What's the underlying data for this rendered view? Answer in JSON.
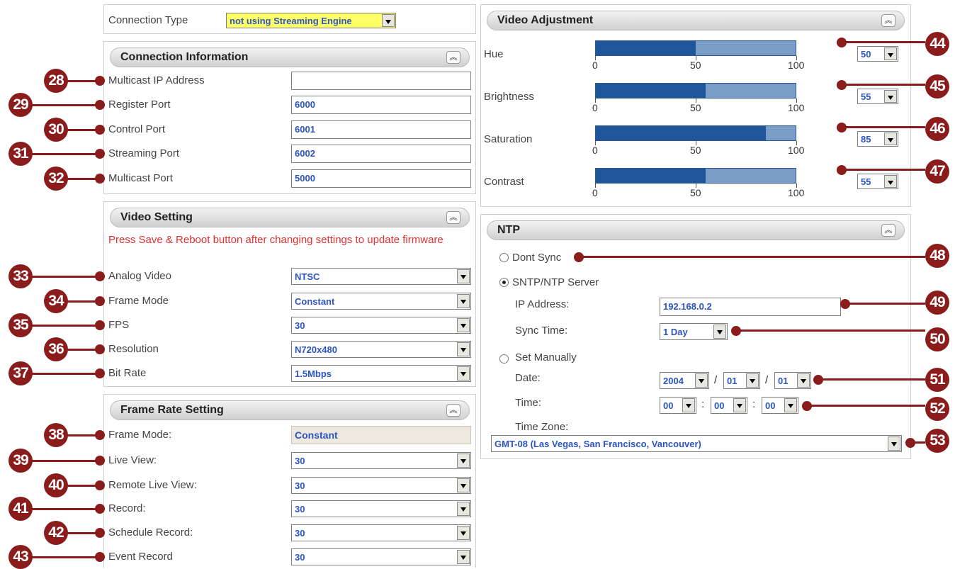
{
  "connection_type": {
    "label": "Connection Type",
    "value": "not using Streaming Engine"
  },
  "connection_info": {
    "title": "Connection Information",
    "fields": [
      {
        "marker": "28",
        "label": "Multicast IP Address",
        "value": ""
      },
      {
        "marker": "29",
        "label": "Register Port",
        "value": "6000"
      },
      {
        "marker": "30",
        "label": "Control Port",
        "value": "6001"
      },
      {
        "marker": "31",
        "label": "Streaming Port",
        "value": "6002"
      },
      {
        "marker": "32",
        "label": "Multicast Port",
        "value": "5000"
      }
    ]
  },
  "video_setting": {
    "title": "Video Setting",
    "warning": "Press Save & Reboot button after changing settings to update firmware",
    "fields": [
      {
        "marker": "33",
        "label": "Analog Video",
        "value": "NTSC"
      },
      {
        "marker": "34",
        "label": "Frame Mode",
        "value": "Constant"
      },
      {
        "marker": "35",
        "label": "FPS",
        "value": "30"
      },
      {
        "marker": "36",
        "label": "Resolution",
        "value": "N720x480"
      },
      {
        "marker": "37",
        "label": "Bit Rate",
        "value": "1.5Mbps"
      }
    ]
  },
  "frame_rate": {
    "title": "Frame Rate Setting",
    "fields": [
      {
        "marker": "38",
        "label": "Frame Mode:",
        "value": "Constant"
      },
      {
        "marker": "39",
        "label": "Live View:",
        "value": "30"
      },
      {
        "marker": "40",
        "label": "Remote Live View:",
        "value": "30"
      },
      {
        "marker": "41",
        "label": "Record:",
        "value": "30"
      },
      {
        "marker": "42",
        "label": "Schedule Record:",
        "value": "30"
      },
      {
        "marker": "43",
        "label": "Event Record",
        "value": "30"
      }
    ]
  },
  "video_adjustment": {
    "title": "Video Adjustment",
    "ticks": [
      "0",
      "50",
      "100"
    ],
    "rows": [
      {
        "marker": "44",
        "label": "Hue",
        "value": 50,
        "select": "50"
      },
      {
        "marker": "45",
        "label": "Brightness",
        "value": 55,
        "select": "55"
      },
      {
        "marker": "46",
        "label": "Saturation",
        "value": 85,
        "select": "85"
      },
      {
        "marker": "47",
        "label": "Contrast",
        "value": 55,
        "select": "55"
      }
    ]
  },
  "ntp": {
    "title": "NTP",
    "dont_sync": "Dont Sync",
    "server_option": "SNTP/NTP Server",
    "ip_label": "IP Address:",
    "ip_value": "192.168.0.2",
    "sync_label": "Sync Time:",
    "sync_value": "1 Day",
    "manual_option": "Set Manually",
    "date_label": "Date:",
    "year": "2004",
    "month": "01",
    "day": "01",
    "time_label": "Time:",
    "hour": "00",
    "minute": "00",
    "second": "00",
    "tz_label": "Time Zone:",
    "tz_value": "GMT-08 (Las Vegas, San Francisco, Vancouver)",
    "markers": {
      "dont_sync": "48",
      "ip": "49",
      "sync": "50",
      "date": "51",
      "time": "52",
      "tz": "53"
    },
    "selected_option": "SNTP/NTP Server"
  },
  "colors": {
    "marker": "#8b1c1c",
    "value_text": "#2b55c4",
    "bar_fill": "#1f5699",
    "bar_bg": "#7b9ec9",
    "warning": "#e03030"
  },
  "separators": {
    "date": "/",
    "time": ":"
  },
  "icons": {
    "collapse": "double-chevron-up-icon",
    "dropdown": "dropdown-arrow-icon"
  }
}
